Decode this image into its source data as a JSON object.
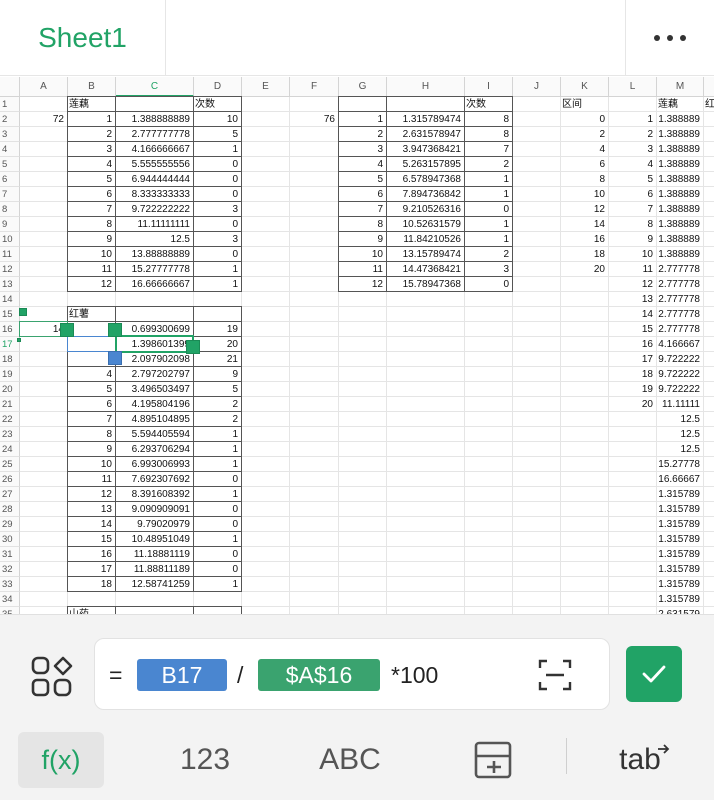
{
  "app": {
    "sheet_tab": "Sheet1"
  },
  "grid": {
    "columns": [
      "A",
      "B",
      "C",
      "D",
      "E",
      "F",
      "G",
      "H",
      "I",
      "J",
      "K",
      "L",
      "M",
      ""
    ],
    "rows": [
      "1",
      "2",
      "3",
      "4",
      "5",
      "6",
      "7",
      "8",
      "9",
      "10",
      "11",
      "12",
      "13",
      "14",
      "15",
      "16",
      "17",
      "18",
      "19",
      "20",
      "21",
      "22",
      "23",
      "24",
      "25",
      "26",
      "27",
      "28",
      "29",
      "30",
      "31",
      "32",
      "33",
      "34",
      "35"
    ],
    "selected_column": "C",
    "selected_row": "17",
    "cells": {
      "B1": "莲藕",
      "D1": "次数",
      "I1": "次数",
      "K1": "区间",
      "M1": "莲藕",
      "N1": "红",
      "A2": "72",
      "B2": "1",
      "C2": "1.388888889",
      "D2": "10",
      "F2": "76",
      "G2": "1",
      "H2": "1.315789474",
      "I2": "8",
      "K2": "0",
      "L2": "1",
      "M2": "1.388889",
      "B3": "2",
      "C3": "2.777777778",
      "D3": "5",
      "G3": "2",
      "H3": "2.631578947",
      "I3": "8",
      "K3": "2",
      "L3": "2",
      "M3": "1.388889",
      "B4": "3",
      "C4": "4.166666667",
      "D4": "1",
      "G4": "3",
      "H4": "3.947368421",
      "I4": "7",
      "K4": "4",
      "L4": "3",
      "M4": "1.388889",
      "B5": "4",
      "C5": "5.555555556",
      "D5": "0",
      "G5": "4",
      "H5": "5.263157895",
      "I5": "2",
      "K5": "6",
      "L5": "4",
      "M5": "1.388889",
      "B6": "5",
      "C6": "6.944444444",
      "D6": "0",
      "G6": "5",
      "H6": "6.578947368",
      "I6": "1",
      "K6": "8",
      "L6": "5",
      "M6": "1.388889",
      "B7": "6",
      "C7": "8.333333333",
      "D7": "0",
      "G7": "6",
      "H7": "7.894736842",
      "I7": "1",
      "K7": "10",
      "L7": "6",
      "M7": "1.388889",
      "B8": "7",
      "C8": "9.722222222",
      "D8": "3",
      "G8": "7",
      "H8": "9.210526316",
      "I8": "0",
      "K8": "12",
      "L8": "7",
      "M8": "1.388889",
      "B9": "8",
      "C9": "11.11111111",
      "D9": "0",
      "G9": "8",
      "H9": "10.52631579",
      "I9": "1",
      "K9": "14",
      "L9": "8",
      "M9": "1.388889",
      "B10": "9",
      "C10": "12.5",
      "D10": "3",
      "G10": "9",
      "H10": "11.84210526",
      "I10": "1",
      "K10": "16",
      "L10": "9",
      "M10": "1.388889",
      "B11": "10",
      "C11": "13.88888889",
      "D11": "0",
      "G11": "10",
      "H11": "13.15789474",
      "I11": "2",
      "K11": "18",
      "L11": "10",
      "M11": "1.388889",
      "B12": "11",
      "C12": "15.27777778",
      "D12": "1",
      "G12": "11",
      "H12": "14.47368421",
      "I12": "3",
      "K12": "20",
      "L12": "11",
      "M12": "2.777778",
      "B13": "12",
      "C13": "16.66666667",
      "D13": "1",
      "G13": "12",
      "H13": "15.78947368",
      "I13": "0",
      "L13": "12",
      "M13": "2.777778",
      "L14": "13",
      "M14": "2.777778",
      "B15": "红薯",
      "L15": "14",
      "M15": "2.777778",
      "A16": "14",
      "C16": "0.699300699",
      "D16": "19",
      "L16": "15",
      "M16": "2.777778",
      "C17": "1.398601399",
      "D17": "20",
      "L17": "16",
      "M17": "4.166667",
      "C18": "2.097902098",
      "D18": "21",
      "L18": "17",
      "M18": "9.722222",
      "B19": "4",
      "C19": "2.797202797",
      "D19": "9",
      "L19": "18",
      "M19": "9.722222",
      "B20": "5",
      "C20": "3.496503497",
      "D20": "5",
      "L20": "19",
      "M20": "9.722222",
      "B21": "6",
      "C21": "4.195804196",
      "D21": "2",
      "L21": "20",
      "M21": "11.11111",
      "B22": "7",
      "C22": "4.895104895",
      "D22": "2",
      "M22": "12.5",
      "B23": "8",
      "C23": "5.594405594",
      "D23": "1",
      "M23": "12.5",
      "B24": "9",
      "C24": "6.293706294",
      "D24": "1",
      "M24": "12.5",
      "B25": "10",
      "C25": "6.993006993",
      "D25": "1",
      "M25": "15.27778",
      "B26": "11",
      "C26": "7.692307692",
      "D26": "0",
      "M26": "16.66667",
      "B27": "12",
      "C27": "8.391608392",
      "D27": "1",
      "M27": "1.315789",
      "B28": "13",
      "C28": "9.090909091",
      "D28": "0",
      "M28": "1.315789",
      "B29": "14",
      "C29": "9.79020979",
      "D29": "0",
      "M29": "1.315789",
      "B30": "15",
      "C30": "10.48951049",
      "D30": "1",
      "M30": "1.315789",
      "B31": "16",
      "C31": "11.18881119",
      "D31": "0",
      "M31": "1.315789",
      "B32": "17",
      "C32": "11.88811189",
      "D32": "0",
      "M32": "1.315789",
      "B33": "18",
      "C33": "12.58741259",
      "D33": "1",
      "M33": "1.315789",
      "M34": "1.315789",
      "B35": "山药",
      "M35": "2.631579"
    }
  },
  "formula_bar": {
    "equals": "=",
    "ref1": "B17",
    "operator": "/",
    "ref2": "$A$16",
    "suffix": "*100",
    "ref1_color": "#4a86d0",
    "ref2_color": "#3aa36f"
  },
  "keyboard_bar": {
    "fx_label": "f(x)",
    "numbers_label": "123",
    "letters_label": "ABC",
    "tab_label": "tab"
  },
  "colors": {
    "accent": "#21a366"
  }
}
